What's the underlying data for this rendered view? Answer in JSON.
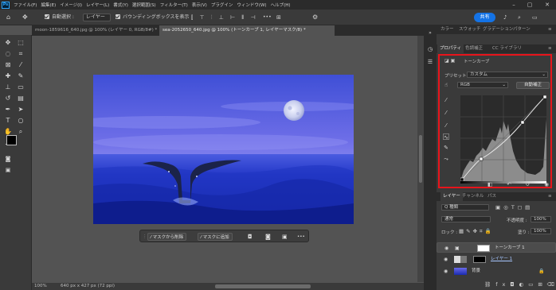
{
  "menubar": {
    "logo": "Ps",
    "items": [
      "ファイル(F)",
      "編集(E)",
      "イメージ(I)",
      "レイヤー(L)",
      "書式(Y)",
      "選択範囲(S)",
      "フィルター(T)",
      "表示(V)",
      "プラグイン",
      "ウィンドウ(W)",
      "ヘルプ(H)"
    ]
  },
  "options": {
    "auto_select_label": "自動選択 :",
    "auto_select_value": "レイヤー",
    "bounding_box_label": "バウンディングボックスを表示",
    "more": "•••",
    "share_label": "共有"
  },
  "tabs": [
    {
      "label": "moon-1859616_640.jpg @ 100% (レイヤー 0, RGB/8#) *",
      "active": false
    },
    {
      "label": "sea-2052650_640.jpg @ 100% (トーンカーブ 1, レイヤーマスク/8) *",
      "active": true
    }
  ],
  "status": {
    "zoom": "100%",
    "dimensions": "640 px x 427 px (72 ppi)"
  },
  "taskbar": {
    "subtract_mask": "マスクから削除",
    "add_mask": "マスクに追加",
    "more": "•••"
  },
  "panels": {
    "top_tabs": [
      "カラー",
      "スウォッチ",
      "グラデーション",
      "パターン"
    ],
    "prop_tabs": [
      "プロパティ",
      "色調補正",
      "CC ライブラリ"
    ],
    "props": {
      "title": "トーンカーブ",
      "preset_label": "プリセット :",
      "preset_value": "カスタム",
      "channel": "RGB",
      "auto_button": "自動補正"
    },
    "layers_tabs": [
      "レイヤー",
      "チャンネル",
      "パス"
    ],
    "layers": {
      "kind_filter": "Q 種類",
      "blend_mode": "通常",
      "opacity_label": "不透明度 :",
      "opacity_value": "100%",
      "lock_label": "ロック :",
      "fill_label": "塗り :",
      "fill_value": "100%",
      "items": [
        {
          "name": "トーンカーブ 1",
          "selected": true
        },
        {
          "name": "レイヤー 1",
          "selected": false
        },
        {
          "name": "背景",
          "selected": false
        }
      ]
    }
  },
  "colors": {
    "accent": "#1473e6",
    "highlight_frame": "#e8141b",
    "background": "#535353"
  }
}
